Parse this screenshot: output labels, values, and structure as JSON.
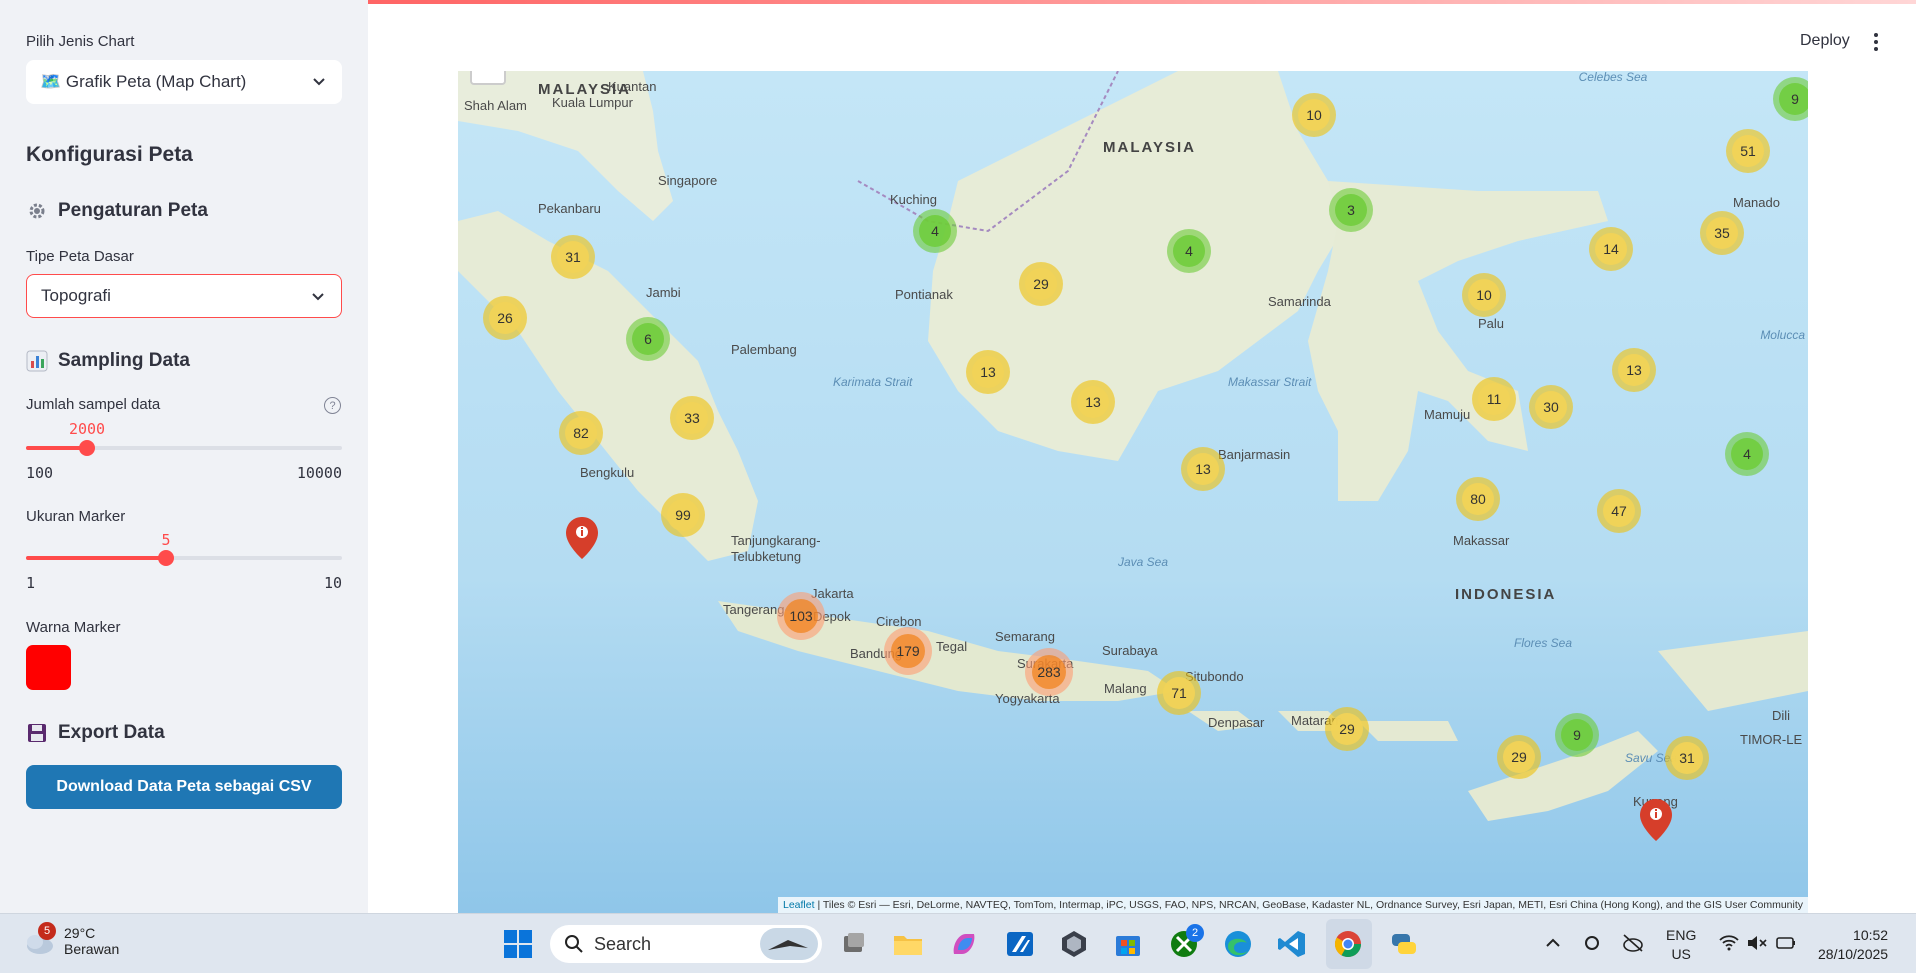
{
  "sidebar": {
    "chart_type_label": "Pilih Jenis Chart",
    "chart_type_value": "🗺️ Grafik Peta (Map Chart)",
    "config_title": "Konfigurasi Peta",
    "map_settings_title": "Pengaturan Peta",
    "basemap_label": "Tipe Peta Dasar",
    "basemap_value": "Topografi",
    "sampling_title": "Sampling Data",
    "sample_slider": {
      "label": "Jumlah sampel data",
      "value": "2000",
      "min": "100",
      "max": "10000",
      "fraction": 0.192
    },
    "marker_slider": {
      "label": "Ukuran Marker",
      "value": "5",
      "min": "1",
      "max": "10",
      "fraction": 0.444
    },
    "marker_color_label": "Warna Marker",
    "marker_color": "#ff0000",
    "export_title": "Export Data",
    "download_button": "Download Data Peta sebagai CSV"
  },
  "header": {
    "deploy_label": "Deploy"
  },
  "map": {
    "places": {
      "malaysia_w": "MALAYSIA",
      "kuantan": "Kuantan",
      "shah_alam": "Shah Alam",
      "kuala_lumpur": "Kuala Lumpur",
      "singapore": "Singapore",
      "pekanbaru": "Pekanbaru",
      "jambi": "Jambi",
      "palembang": "Palembang",
      "bengkulu": "Bengkulu",
      "tanjungkarang": "Tanjungkarang-",
      "telubketung": "Telubketung",
      "jakarta": "Jakarta",
      "tangerang": "Tangerang",
      "depok": "Depok",
      "cirebon": "Cirebon",
      "bandung": "Bandung",
      "tegal": "Tegal",
      "semarang": "Semarang",
      "surakarta": "Surakarta",
      "yogyakarta": "Yogyakarta",
      "surabaya": "Surabaya",
      "malang": "Malang",
      "situbondo": "Situbondo",
      "denpasar": "Denpasar",
      "mataram": "Mataram",
      "kupang": "Kupang",
      "dili": "Dili",
      "timor": "TIMOR-LE",
      "malaysia_e": "MALAYSIA",
      "kuching": "Kuching",
      "pontianak": "Pontianak",
      "samarinda": "Samarinda",
      "banjarmasin": "Banjarmasin",
      "palu": "Palu",
      "mamuju": "Mamuju",
      "makassar": "Makassar",
      "manado": "Manado",
      "indonesia": "INDONESIA"
    },
    "seas": {
      "karimata": "Karimata Strait",
      "makassar_strait": "Makassar Strait",
      "java_sea": "Java Sea",
      "flores_sea": "Flores Sea",
      "savu_sea": "Savu Sea",
      "celebes_sea": "Celebes Sea",
      "molucca_sea": "Molucca Sea"
    },
    "clusters": [
      {
        "count": "31",
        "tier": "med"
      },
      {
        "count": "26",
        "tier": "med"
      },
      {
        "count": "6",
        "tier": "small"
      },
      {
        "count": "82",
        "tier": "med"
      },
      {
        "count": "33",
        "tier": "med"
      },
      {
        "count": "99",
        "tier": "med"
      },
      {
        "count": "103",
        "tier": "large"
      },
      {
        "count": "179",
        "tier": "large"
      },
      {
        "count": "283",
        "tier": "large"
      },
      {
        "count": "71",
        "tier": "med"
      },
      {
        "count": "29",
        "tier": "med"
      },
      {
        "count": "29",
        "tier": "med"
      },
      {
        "count": "9",
        "tier": "small"
      },
      {
        "count": "31",
        "tier": "med"
      },
      {
        "count": "4",
        "tier": "small"
      },
      {
        "count": "29",
        "tier": "med"
      },
      {
        "count": "4",
        "tier": "small"
      },
      {
        "count": "10",
        "tier": "med"
      },
      {
        "count": "3",
        "tier": "small"
      },
      {
        "count": "13",
        "tier": "med"
      },
      {
        "count": "11",
        "tier": "med"
      },
      {
        "count": "13",
        "tier": "med"
      },
      {
        "count": "13",
        "tier": "med"
      },
      {
        "count": "51",
        "tier": "med"
      },
      {
        "count": "10",
        "tier": "med"
      },
      {
        "count": "14",
        "tier": "med"
      },
      {
        "count": "35",
        "tier": "med"
      },
      {
        "count": "13",
        "tier": "med"
      },
      {
        "count": "30",
        "tier": "med"
      },
      {
        "count": "4",
        "tier": "small"
      },
      {
        "count": "80",
        "tier": "med"
      },
      {
        "count": "47",
        "tier": "med"
      },
      {
        "count": "9",
        "tier": "small"
      }
    ],
    "attribution_link": "Leaflet",
    "attribution_text": " | Tiles © Esri — Esri, DeLorme, NAVTEQ, TomTom, Intermap, iPC, USGS, FAO, NPS, NRCAN, GeoBase, Kadaster NL, Ordnance Survey, Esri Japan, METI, Esri China (Hong Kong), and the GIS User Community"
  },
  "taskbar": {
    "weather_badge": "5",
    "temperature": "29°C",
    "condition": "Berawan",
    "search_placeholder": "Search",
    "xbox_badge": "2",
    "lang_top": "ENG",
    "lang_bottom": "US",
    "time": "10:52",
    "date": "28/10/2025"
  }
}
